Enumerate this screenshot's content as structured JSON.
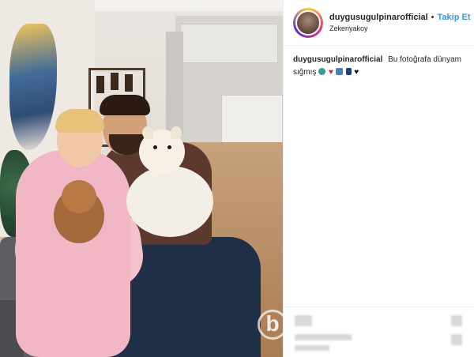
{
  "post": {
    "username": "duygusugulpinarofficial",
    "follow_label": "Takip Et",
    "location": "Zekeriyakoy",
    "caption_user": "duygusugulpinarofficial",
    "caption_text": "Bu fotoğrafa dünyam sığmış",
    "caption_emojis": [
      "globe-icon",
      "heart-icon",
      "family-icon",
      "phone-icon",
      "black-heart-icon"
    ]
  },
  "photo": {
    "watermark": "b"
  },
  "colors": {
    "link": "#3897f0",
    "text": "#262626",
    "border": "#efefef"
  }
}
